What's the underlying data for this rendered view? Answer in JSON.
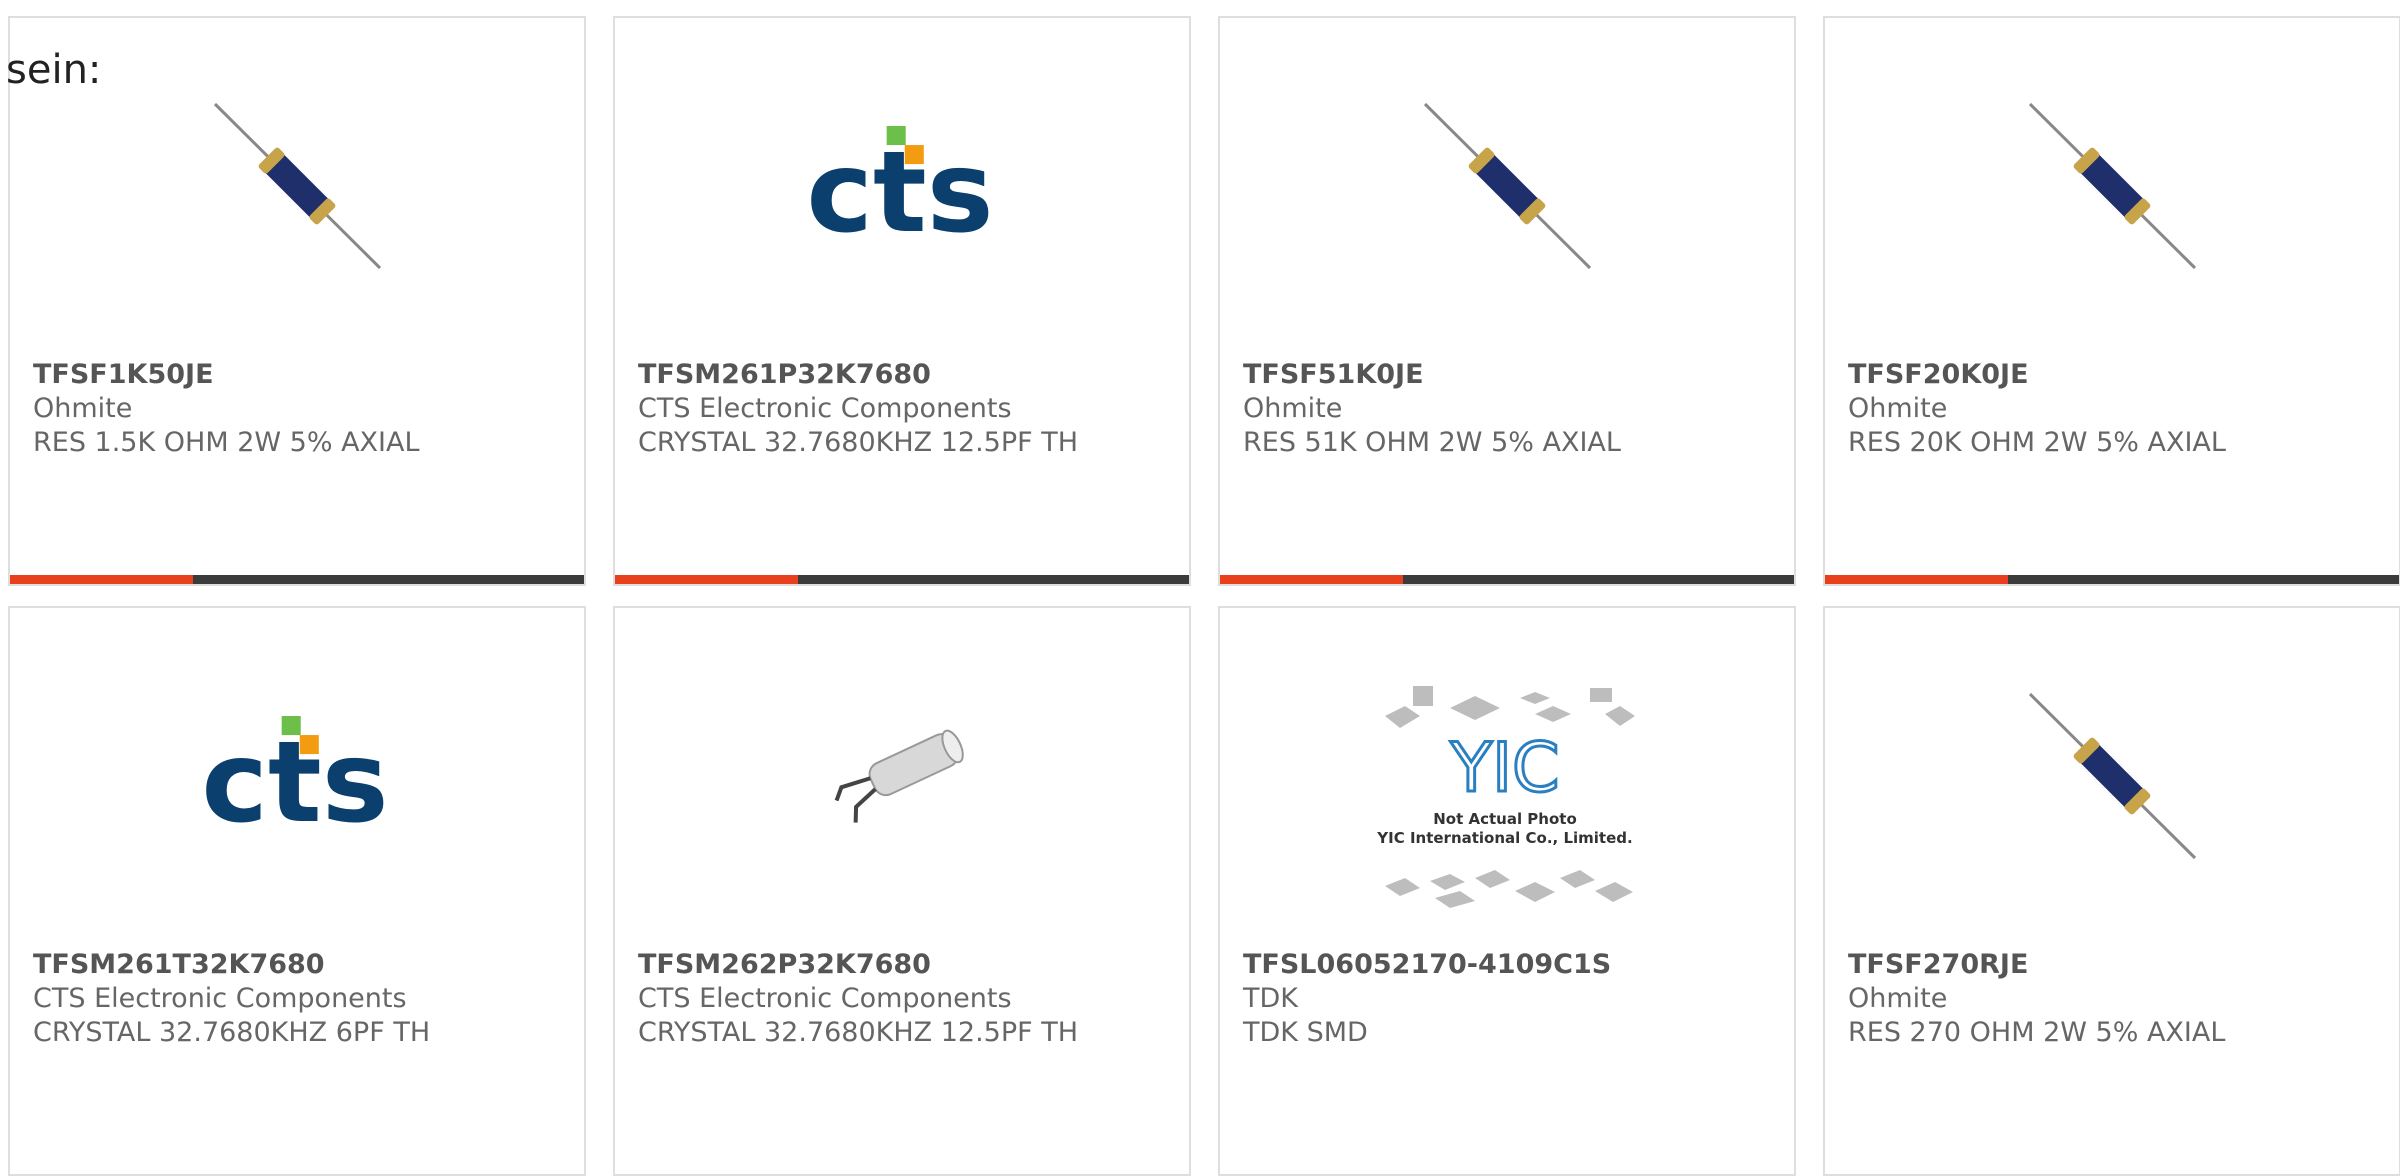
{
  "intro_text": "sein:",
  "accent_color": "#e8401c",
  "bar_color": "#3b3b3b",
  "progress_fraction": 0.32,
  "products": [
    {
      "part_number": "TFSF1K50JE",
      "manufacturer": "Ohmite",
      "description": "RES 1.5K OHM 2W 5% AXIAL",
      "image": "axial-resistor-icon"
    },
    {
      "part_number": "TFSM261P32K7680",
      "manufacturer": "CTS Electronic Components",
      "description": "CRYSTAL 32.7680KHZ 12.5PF TH",
      "image": "cts-logo",
      "logo_text": "cts"
    },
    {
      "part_number": "TFSF51K0JE",
      "manufacturer": "Ohmite",
      "description": "RES 51K OHM 2W 5% AXIAL",
      "image": "axial-resistor-icon"
    },
    {
      "part_number": "TFSF20K0JE",
      "manufacturer": "Ohmite",
      "description": "RES 20K OHM 2W 5% AXIAL",
      "image": "axial-resistor-icon"
    },
    {
      "part_number": "TFSM261T32K7680",
      "manufacturer": "CTS Electronic Components",
      "description": "CRYSTAL 32.7680KHZ 6PF TH",
      "image": "cts-logo",
      "logo_text": "cts"
    },
    {
      "part_number": "TFSM262P32K7680",
      "manufacturer": "CTS Electronic Components",
      "description": "CRYSTAL 32.7680KHZ 12.5PF TH",
      "image": "cylinder-crystal-icon"
    },
    {
      "part_number": "TFSL06052170-4109C1S",
      "manufacturer": "TDK",
      "description": "TDK SMD",
      "image": "yic-placeholder",
      "placeholder_line1": "Not Actual Photo",
      "placeholder_line2": "YIC International Co., Limited.",
      "placeholder_logo": "YIC"
    },
    {
      "part_number": "TFSF270RJE",
      "manufacturer": "Ohmite",
      "description": "RES 270 OHM 2W 5% AXIAL",
      "image": "axial-resistor-icon"
    }
  ]
}
